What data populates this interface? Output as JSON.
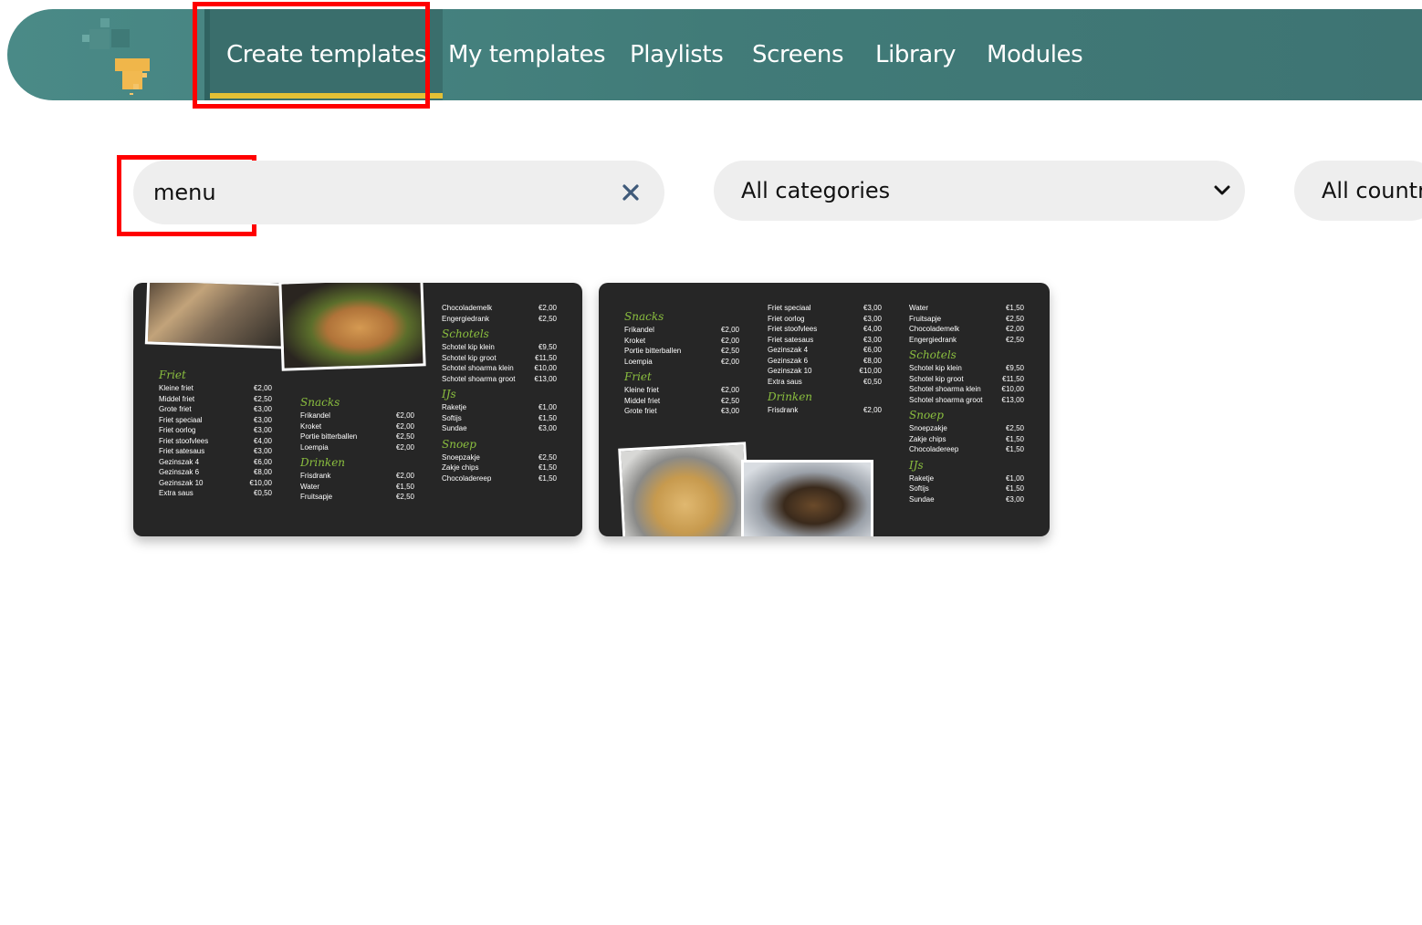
{
  "nav": {
    "items": [
      {
        "label": "Create templates",
        "active": true
      },
      {
        "label": "My templates"
      },
      {
        "label": "Playlists"
      },
      {
        "label": "Screens"
      },
      {
        "label": "Library"
      },
      {
        "label": "Modules"
      }
    ]
  },
  "filters": {
    "search_value": "menu",
    "category_label": "All categories",
    "country_label": "All countr"
  },
  "colors": {
    "nav_bg": "#417b78",
    "active_underline": "#e3c035",
    "highlight": "#ff0000",
    "card_bg": "#262626",
    "section_green": "#8bbf3f"
  },
  "card1": {
    "col1": {
      "sections": [
        {
          "title": "Friet",
          "items": [
            [
              "Kleine friet",
              "€2,00"
            ],
            [
              "Middel friet",
              "€2,50"
            ],
            [
              "Grote friet",
              "€3,00"
            ],
            [
              "Friet speciaal",
              "€3,00"
            ],
            [
              "Friet oorlog",
              "€3,00"
            ],
            [
              "Friet stoofvlees",
              "€4,00"
            ],
            [
              "Friet satesaus",
              "€3,00"
            ],
            [
              "Gezinszak 4",
              "€6,00"
            ],
            [
              "Gezinszak 6",
              "€8,00"
            ],
            [
              "Gezinszak 10",
              "€10,00"
            ],
            [
              "Extra saus",
              "€0,50"
            ]
          ]
        }
      ]
    },
    "col2": {
      "sections": [
        {
          "title": "Snacks",
          "items": [
            [
              "Frikandel",
              "€2,00"
            ],
            [
              "Kroket",
              "€2,00"
            ],
            [
              "Portie bitterballen",
              "€2,50"
            ],
            [
              "Loempia",
              "€2,00"
            ]
          ]
        },
        {
          "title": "Drinken",
          "items": [
            [
              "Frisdrank",
              "€2,00"
            ],
            [
              "Water",
              "€1,50"
            ],
            [
              "Fruitsapje",
              "€2,50"
            ]
          ]
        }
      ]
    },
    "col3": {
      "sections": [
        {
          "title": "",
          "items": [
            [
              "Chocolademelk",
              "€2,00"
            ],
            [
              "Engergiedrank",
              "€2,50"
            ]
          ]
        },
        {
          "title": "Schotels",
          "items": [
            [
              "Schotel kip klein",
              "€9,50"
            ],
            [
              "Schotel kip groot",
              "€11,50"
            ],
            [
              "Schotel shoarma klein",
              "€10,00"
            ],
            [
              "Schotel shoarma groot",
              "€13,00"
            ]
          ]
        },
        {
          "title": "IJs",
          "items": [
            [
              "Raketje",
              "€1,00"
            ],
            [
              "Softijs",
              "€1,50"
            ],
            [
              "Sundae",
              "€3,00"
            ]
          ]
        },
        {
          "title": "Snoep",
          "items": [
            [
              "Snoepzakje",
              "€2,50"
            ],
            [
              "Zakje chips",
              "€1,50"
            ],
            [
              "Chocoladereep",
              "€1,50"
            ]
          ]
        }
      ]
    }
  },
  "card2": {
    "col1": {
      "sections": [
        {
          "title": "Snacks",
          "items": [
            [
              "Frikandel",
              "€2,00"
            ],
            [
              "Kroket",
              "€2,00"
            ],
            [
              "Portie bitterballen",
              "€2,50"
            ],
            [
              "Loempia",
              "€2,00"
            ]
          ]
        },
        {
          "title": "Friet",
          "items": [
            [
              "Kleine friet",
              "€2,00"
            ],
            [
              "Middel friet",
              "€2,50"
            ],
            [
              "Grote friet",
              "€3,00"
            ]
          ]
        }
      ]
    },
    "col2": {
      "sections": [
        {
          "title": "",
          "items": [
            [
              "Friet speciaal",
              "€3,00"
            ],
            [
              "Friet oorlog",
              "€3,00"
            ],
            [
              "Friet stoofvlees",
              "€4,00"
            ],
            [
              "Friet satesaus",
              "€3,00"
            ],
            [
              "Gezinszak 4",
              "€6,00"
            ],
            [
              "Gezinszak 6",
              "€8,00"
            ],
            [
              "Gezinszak 10",
              "€10,00"
            ],
            [
              "Extra saus",
              "€0,50"
            ]
          ]
        },
        {
          "title": "Drinken",
          "items": [
            [
              "Frisdrank",
              "€2,00"
            ]
          ]
        }
      ]
    },
    "col3": {
      "sections": [
        {
          "title": "",
          "items": [
            [
              "Water",
              "€1,50"
            ],
            [
              "Fruitsapje",
              "€2,50"
            ],
            [
              "Chocolademelk",
              "€2,00"
            ],
            [
              "Engergiedrank",
              "€2,50"
            ]
          ]
        },
        {
          "title": "Schotels",
          "items": [
            [
              "Schotel kip klein",
              "€9,50"
            ],
            [
              "Schotel kip groot",
              "€11,50"
            ],
            [
              "Schotel shoarma klein",
              "€10,00"
            ],
            [
              "Schotel shoarma groot",
              "€13,00"
            ]
          ]
        },
        {
          "title": "Snoep",
          "items": [
            [
              "Snoepzakje",
              "€2,50"
            ],
            [
              "Zakje chips",
              "€1,50"
            ],
            [
              "Chocoladereep",
              "€1,50"
            ]
          ]
        },
        {
          "title": "IJs",
          "items": [
            [
              "Raketje",
              "€1,00"
            ],
            [
              "Softijs",
              "€1,50"
            ],
            [
              "Sundae",
              "€3,00"
            ]
          ]
        }
      ]
    }
  }
}
